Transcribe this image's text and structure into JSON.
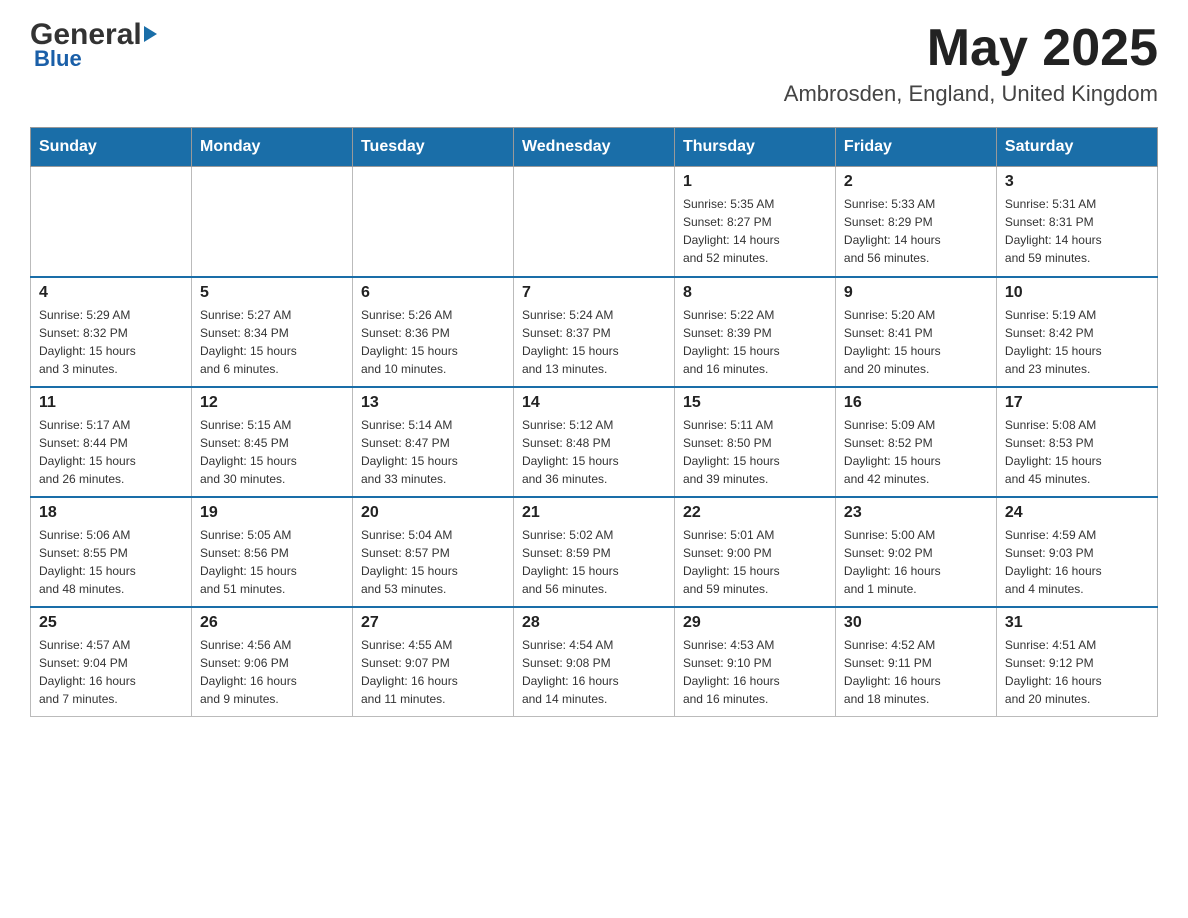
{
  "header": {
    "logo_general": "General",
    "logo_blue": "Blue",
    "main_title": "May 2025",
    "subtitle": "Ambrosden, England, United Kingdom"
  },
  "days_of_week": [
    "Sunday",
    "Monday",
    "Tuesday",
    "Wednesday",
    "Thursday",
    "Friday",
    "Saturday"
  ],
  "weeks": [
    {
      "days": [
        {
          "number": "",
          "info": ""
        },
        {
          "number": "",
          "info": ""
        },
        {
          "number": "",
          "info": ""
        },
        {
          "number": "",
          "info": ""
        },
        {
          "number": "1",
          "info": "Sunrise: 5:35 AM\nSunset: 8:27 PM\nDaylight: 14 hours\nand 52 minutes."
        },
        {
          "number": "2",
          "info": "Sunrise: 5:33 AM\nSunset: 8:29 PM\nDaylight: 14 hours\nand 56 minutes."
        },
        {
          "number": "3",
          "info": "Sunrise: 5:31 AM\nSunset: 8:31 PM\nDaylight: 14 hours\nand 59 minutes."
        }
      ]
    },
    {
      "days": [
        {
          "number": "4",
          "info": "Sunrise: 5:29 AM\nSunset: 8:32 PM\nDaylight: 15 hours\nand 3 minutes."
        },
        {
          "number": "5",
          "info": "Sunrise: 5:27 AM\nSunset: 8:34 PM\nDaylight: 15 hours\nand 6 minutes."
        },
        {
          "number": "6",
          "info": "Sunrise: 5:26 AM\nSunset: 8:36 PM\nDaylight: 15 hours\nand 10 minutes."
        },
        {
          "number": "7",
          "info": "Sunrise: 5:24 AM\nSunset: 8:37 PM\nDaylight: 15 hours\nand 13 minutes."
        },
        {
          "number": "8",
          "info": "Sunrise: 5:22 AM\nSunset: 8:39 PM\nDaylight: 15 hours\nand 16 minutes."
        },
        {
          "number": "9",
          "info": "Sunrise: 5:20 AM\nSunset: 8:41 PM\nDaylight: 15 hours\nand 20 minutes."
        },
        {
          "number": "10",
          "info": "Sunrise: 5:19 AM\nSunset: 8:42 PM\nDaylight: 15 hours\nand 23 minutes."
        }
      ]
    },
    {
      "days": [
        {
          "number": "11",
          "info": "Sunrise: 5:17 AM\nSunset: 8:44 PM\nDaylight: 15 hours\nand 26 minutes."
        },
        {
          "number": "12",
          "info": "Sunrise: 5:15 AM\nSunset: 8:45 PM\nDaylight: 15 hours\nand 30 minutes."
        },
        {
          "number": "13",
          "info": "Sunrise: 5:14 AM\nSunset: 8:47 PM\nDaylight: 15 hours\nand 33 minutes."
        },
        {
          "number": "14",
          "info": "Sunrise: 5:12 AM\nSunset: 8:48 PM\nDaylight: 15 hours\nand 36 minutes."
        },
        {
          "number": "15",
          "info": "Sunrise: 5:11 AM\nSunset: 8:50 PM\nDaylight: 15 hours\nand 39 minutes."
        },
        {
          "number": "16",
          "info": "Sunrise: 5:09 AM\nSunset: 8:52 PM\nDaylight: 15 hours\nand 42 minutes."
        },
        {
          "number": "17",
          "info": "Sunrise: 5:08 AM\nSunset: 8:53 PM\nDaylight: 15 hours\nand 45 minutes."
        }
      ]
    },
    {
      "days": [
        {
          "number": "18",
          "info": "Sunrise: 5:06 AM\nSunset: 8:55 PM\nDaylight: 15 hours\nand 48 minutes."
        },
        {
          "number": "19",
          "info": "Sunrise: 5:05 AM\nSunset: 8:56 PM\nDaylight: 15 hours\nand 51 minutes."
        },
        {
          "number": "20",
          "info": "Sunrise: 5:04 AM\nSunset: 8:57 PM\nDaylight: 15 hours\nand 53 minutes."
        },
        {
          "number": "21",
          "info": "Sunrise: 5:02 AM\nSunset: 8:59 PM\nDaylight: 15 hours\nand 56 minutes."
        },
        {
          "number": "22",
          "info": "Sunrise: 5:01 AM\nSunset: 9:00 PM\nDaylight: 15 hours\nand 59 minutes."
        },
        {
          "number": "23",
          "info": "Sunrise: 5:00 AM\nSunset: 9:02 PM\nDaylight: 16 hours\nand 1 minute."
        },
        {
          "number": "24",
          "info": "Sunrise: 4:59 AM\nSunset: 9:03 PM\nDaylight: 16 hours\nand 4 minutes."
        }
      ]
    },
    {
      "days": [
        {
          "number": "25",
          "info": "Sunrise: 4:57 AM\nSunset: 9:04 PM\nDaylight: 16 hours\nand 7 minutes."
        },
        {
          "number": "26",
          "info": "Sunrise: 4:56 AM\nSunset: 9:06 PM\nDaylight: 16 hours\nand 9 minutes."
        },
        {
          "number": "27",
          "info": "Sunrise: 4:55 AM\nSunset: 9:07 PM\nDaylight: 16 hours\nand 11 minutes."
        },
        {
          "number": "28",
          "info": "Sunrise: 4:54 AM\nSunset: 9:08 PM\nDaylight: 16 hours\nand 14 minutes."
        },
        {
          "number": "29",
          "info": "Sunrise: 4:53 AM\nSunset: 9:10 PM\nDaylight: 16 hours\nand 16 minutes."
        },
        {
          "number": "30",
          "info": "Sunrise: 4:52 AM\nSunset: 9:11 PM\nDaylight: 16 hours\nand 18 minutes."
        },
        {
          "number": "31",
          "info": "Sunrise: 4:51 AM\nSunset: 9:12 PM\nDaylight: 16 hours\nand 20 minutes."
        }
      ]
    }
  ]
}
